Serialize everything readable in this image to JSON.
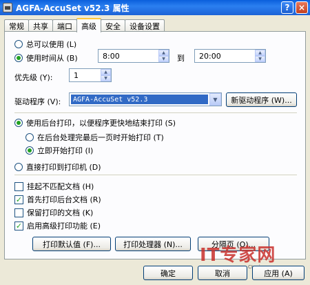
{
  "window": {
    "title": "AGFA-AccuSet v52.3 属性",
    "help_glyph": "?",
    "close_glyph": "×"
  },
  "tabs": [
    {
      "label": "常规"
    },
    {
      "label": "共享"
    },
    {
      "label": "端口"
    },
    {
      "label": "高级",
      "active": true
    },
    {
      "label": "安全"
    },
    {
      "label": "设备设置"
    }
  ],
  "availability": {
    "always_label": "总可以使用 (L)",
    "from_label": "使用时间从 (B)",
    "selected": "from",
    "start_time": "8:00",
    "to_label": "到",
    "end_time": "20:00"
  },
  "priority": {
    "label": "优先级 (Y):",
    "value": "1"
  },
  "driver": {
    "label": "驱动程序 (V):",
    "value": "AGFA-AccuSet v52.3",
    "new_driver_button": "新驱动程序 (W)..."
  },
  "spooling": {
    "spool_label": "使用后台打印，以便程序更快地结束打印 (S)",
    "after_last_page_label": "在后台处理完最后一页时开始打印 (T)",
    "immediately_label": "立即开始打印 (I)",
    "direct_label": "直接打印到打印机 (D)",
    "selected_main": "spool",
    "selected_sub": "immediately"
  },
  "options": [
    {
      "label": "挂起不匹配文档 (H)",
      "checked": false
    },
    {
      "label": "首先打印后台文档 (R)",
      "checked": true
    },
    {
      "label": "保留打印的文档 (K)",
      "checked": false
    },
    {
      "label": "启用高级打印功能 (E)",
      "checked": true
    }
  ],
  "panel_buttons": {
    "defaults": "打印默认值 (F)...",
    "processor": "打印处理器 (N)...",
    "separator": "分隔页 (O)..."
  },
  "dialog_buttons": {
    "ok": "确定",
    "cancel": "取消",
    "apply": "应用 (A)"
  },
  "watermark": {
    "main": "IT专家网",
    "sub": "Ctocio.com"
  },
  "colors": {
    "titlebar": "#0a5fdc",
    "dialog_bg": "#ece9d8",
    "selection": "#316ac5",
    "check_mark": "#21a121"
  }
}
